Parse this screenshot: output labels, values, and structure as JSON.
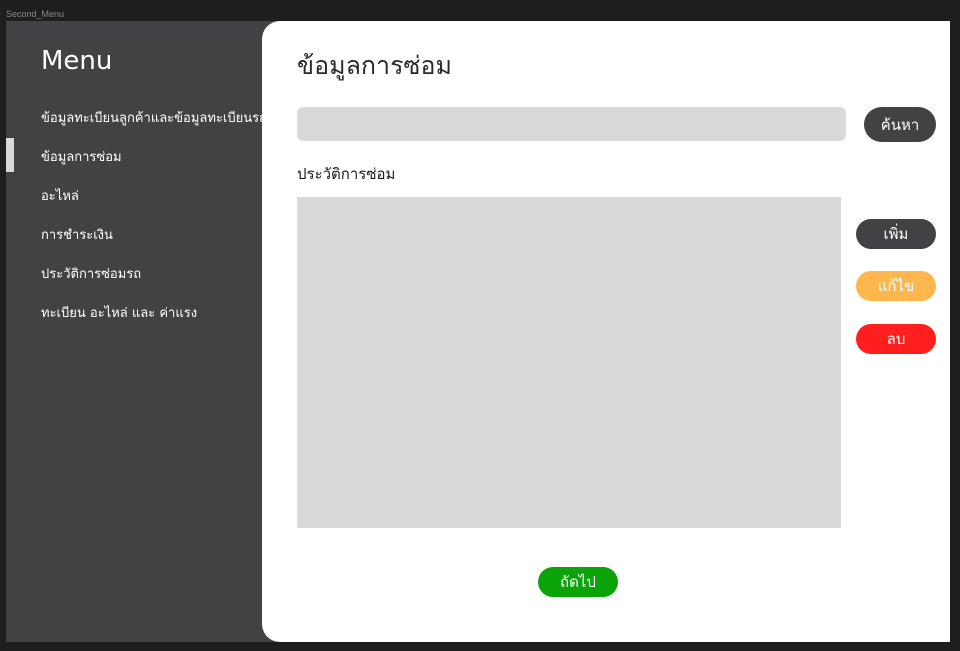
{
  "frame": {
    "label": "Second_Menu"
  },
  "sidebar": {
    "title": "Menu",
    "active_index": 1,
    "items": [
      {
        "label": "ข้อมูลทะเบียนลูกค้าและข้อมูลทะเบียนรถ"
      },
      {
        "label": "ข้อมูลการซ่อม"
      },
      {
        "label": "อะไหล่"
      },
      {
        "label": "การชำระเงิน"
      },
      {
        "label": "ประวัติการซ่อมรถ"
      },
      {
        "label": "ทะเบียน อะไหล่ และ ค่าแรง"
      }
    ]
  },
  "main": {
    "title": "ข้อมูลการซ่อม",
    "search": {
      "value": "",
      "placeholder": ""
    },
    "search_button": "ค้นหา",
    "history_label": "ประวัติการซ่อม",
    "actions": {
      "add": "เพิ่ม",
      "edit": "แก้ไข",
      "delete": "ลบ"
    },
    "next_button": "ถัดไป"
  },
  "colors": {
    "sidebar_bg": "#424244",
    "panel_gray": "#d9d9d9",
    "dark_button": "#424244",
    "edit_orange": "#ffb74d",
    "delete_red": "#ff1f1f",
    "next_green": "#0aa30a"
  }
}
